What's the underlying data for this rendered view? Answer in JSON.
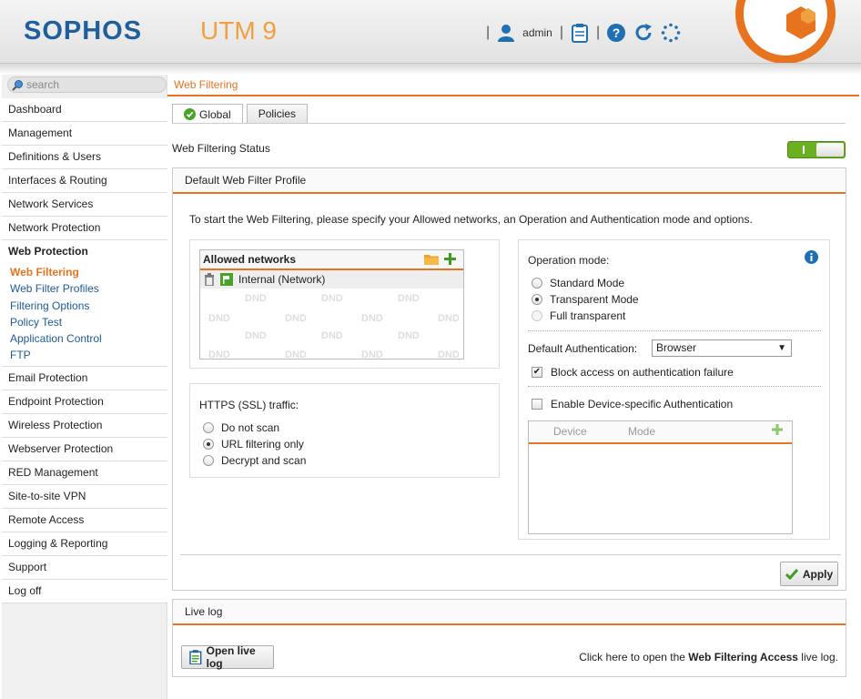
{
  "header": {
    "logo": "SOPHOS",
    "product": "UTM 9",
    "username": "admin",
    "separator": "|",
    "icons": [
      "user-icon",
      "clipboard-icon",
      "help-icon",
      "reload-icon",
      "spinner-icon"
    ]
  },
  "sidebar": {
    "search_placeholder": "search",
    "items": [
      {
        "label": "Dashboard"
      },
      {
        "label": "Management"
      },
      {
        "label": "Definitions & Users"
      },
      {
        "label": "Interfaces & Routing"
      },
      {
        "label": "Network Services"
      },
      {
        "label": "Network Protection"
      },
      {
        "label": "Web Protection"
      },
      {
        "label": "Email Protection"
      },
      {
        "label": "Endpoint Protection"
      },
      {
        "label": "Wireless Protection"
      },
      {
        "label": "Webserver Protection"
      },
      {
        "label": "RED Management"
      },
      {
        "label": "Site-to-site VPN"
      },
      {
        "label": "Remote Access"
      },
      {
        "label": "Logging & Reporting"
      },
      {
        "label": "Support"
      },
      {
        "label": "Log off"
      }
    ],
    "subitems": [
      {
        "label": "Web Filtering"
      },
      {
        "label": "Web Filter Profiles"
      },
      {
        "label": "Filtering Options"
      },
      {
        "label": "Policy Test"
      },
      {
        "label": "Application Control"
      },
      {
        "label": "FTP"
      }
    ]
  },
  "main": {
    "breadcrumb": "Web Filtering",
    "tabs": [
      {
        "label": "Global"
      },
      {
        "label": "Policies"
      }
    ],
    "status_label": "Web Filtering Status",
    "status_enabled": true,
    "status_color": "#6ab023",
    "profile": {
      "title": "Default Web Filter Profile",
      "intro": "To start the Web Filtering, please specify your Allowed networks, an Operation and Authentication mode and options.",
      "allowed_networks": {
        "title": "Allowed networks",
        "entries": [
          "Internal (Network)"
        ],
        "dnd": "DND"
      },
      "https": {
        "title": "HTTPS (SSL) traffic:",
        "options": [
          "Do not scan",
          "URL filtering only",
          "Decrypt and scan"
        ],
        "selected": "URL filtering only"
      },
      "operation": {
        "title": "Operation mode:",
        "options": [
          "Standard Mode",
          "Transparent Mode",
          "Full transparent"
        ],
        "selected": "Transparent Mode",
        "auth_label": "Default Authentication:",
        "auth_value": "Browser",
        "block_label": "Block access on authentication failure",
        "block_checked": true,
        "device_label": "Enable Device-specific Authentication",
        "device_checked": false,
        "device_columns": [
          "Device",
          "Mode"
        ]
      },
      "apply_label": "Apply"
    },
    "livelog": {
      "title": "Live log",
      "button": "Open live log",
      "text_pre": "Click here to open the ",
      "text_bold": "Web Filtering Access",
      "text_post": " live log."
    }
  },
  "colors": {
    "accent": "#e8731e",
    "link": "#1d5a98",
    "brand": "#1f5f9e",
    "product": "#f0a040"
  }
}
